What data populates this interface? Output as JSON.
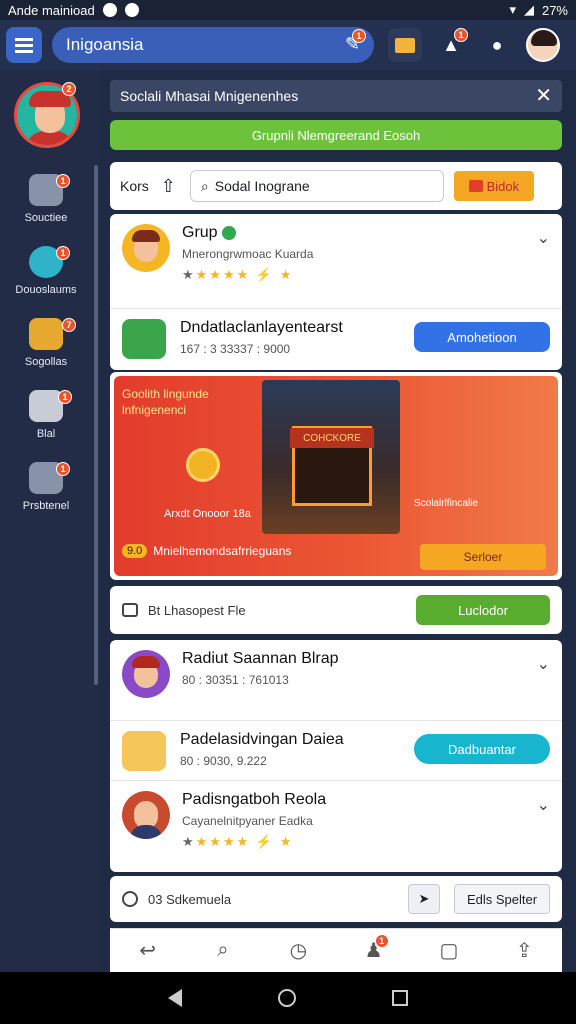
{
  "statusbar": {
    "left_text": "Ande mainioad",
    "battery": "27%"
  },
  "appbar": {
    "title": "Inigoansia",
    "badges": {
      "tools": "1",
      "bell": "1"
    }
  },
  "sidebar": {
    "items": [
      {
        "label": "Souctiee",
        "icon": "camera-icon",
        "badge": "1"
      },
      {
        "label": "Douoslaums",
        "icon": "chat-bubble-icon",
        "badge": "1"
      },
      {
        "label": "Sogollas",
        "icon": "box-icon",
        "badge": "7"
      },
      {
        "label": "Blal",
        "icon": "profile-card-icon",
        "badge": "1"
      },
      {
        "label": "Prsbtenel",
        "icon": "inbox-icon",
        "badge": "1"
      }
    ],
    "avatar_badge": "2"
  },
  "search_banner": {
    "text": "Soclali Mhasai Mnigenenhes"
  },
  "green_bar": {
    "text": "Grupnli Nlemgreerand Eosoh"
  },
  "filter": {
    "label": "Kors",
    "search_value": "Sodal Inograne",
    "button": "Bidok"
  },
  "list1": [
    {
      "title": "Grup",
      "subtitle": "Mnerongrwmoac Kuarda",
      "has_stars": true
    },
    {
      "title": "Dndatlaclanlayentearst",
      "subtitle": "167 : 3 33337 : 9000",
      "button": "Amohetioon"
    }
  ],
  "promo": {
    "title": "Goolith lingunde lnfnigenenci",
    "left_sub": "Arxdt Onooor 18a",
    "sign": "COHCKORE",
    "right_sub": "Scolalrlfincalie",
    "bottom_num": "9.0",
    "bottom_text": "Mnielhemondsafrrieguans",
    "cta": "Serloer"
  },
  "message_row": {
    "text": "Bt Lhasopest Fle",
    "button": "Luclodor"
  },
  "list2": [
    {
      "title": "Radiut Saannan Blrap",
      "subtitle": "80 : 30351 : 761013"
    },
    {
      "title": "Padelasidvingan Daiea",
      "subtitle": "80 : 9030, 9.222",
      "button": "Dadbuantar"
    },
    {
      "title": "Padisngatboh Reola",
      "subtitle": "Cayanelnitpyaner Eadka",
      "has_stars": true
    }
  ],
  "bottom_row": {
    "text": "03 Sdkemuela",
    "edit": "Edls Spelter"
  },
  "tabbar": {
    "notif_badge": "1"
  },
  "colors": {
    "primary_blue": "#3a5fb8",
    "green": "#6cc23a",
    "orange": "#f5a623",
    "teal": "#18b5cf",
    "promo_red": "#e23c2d"
  }
}
